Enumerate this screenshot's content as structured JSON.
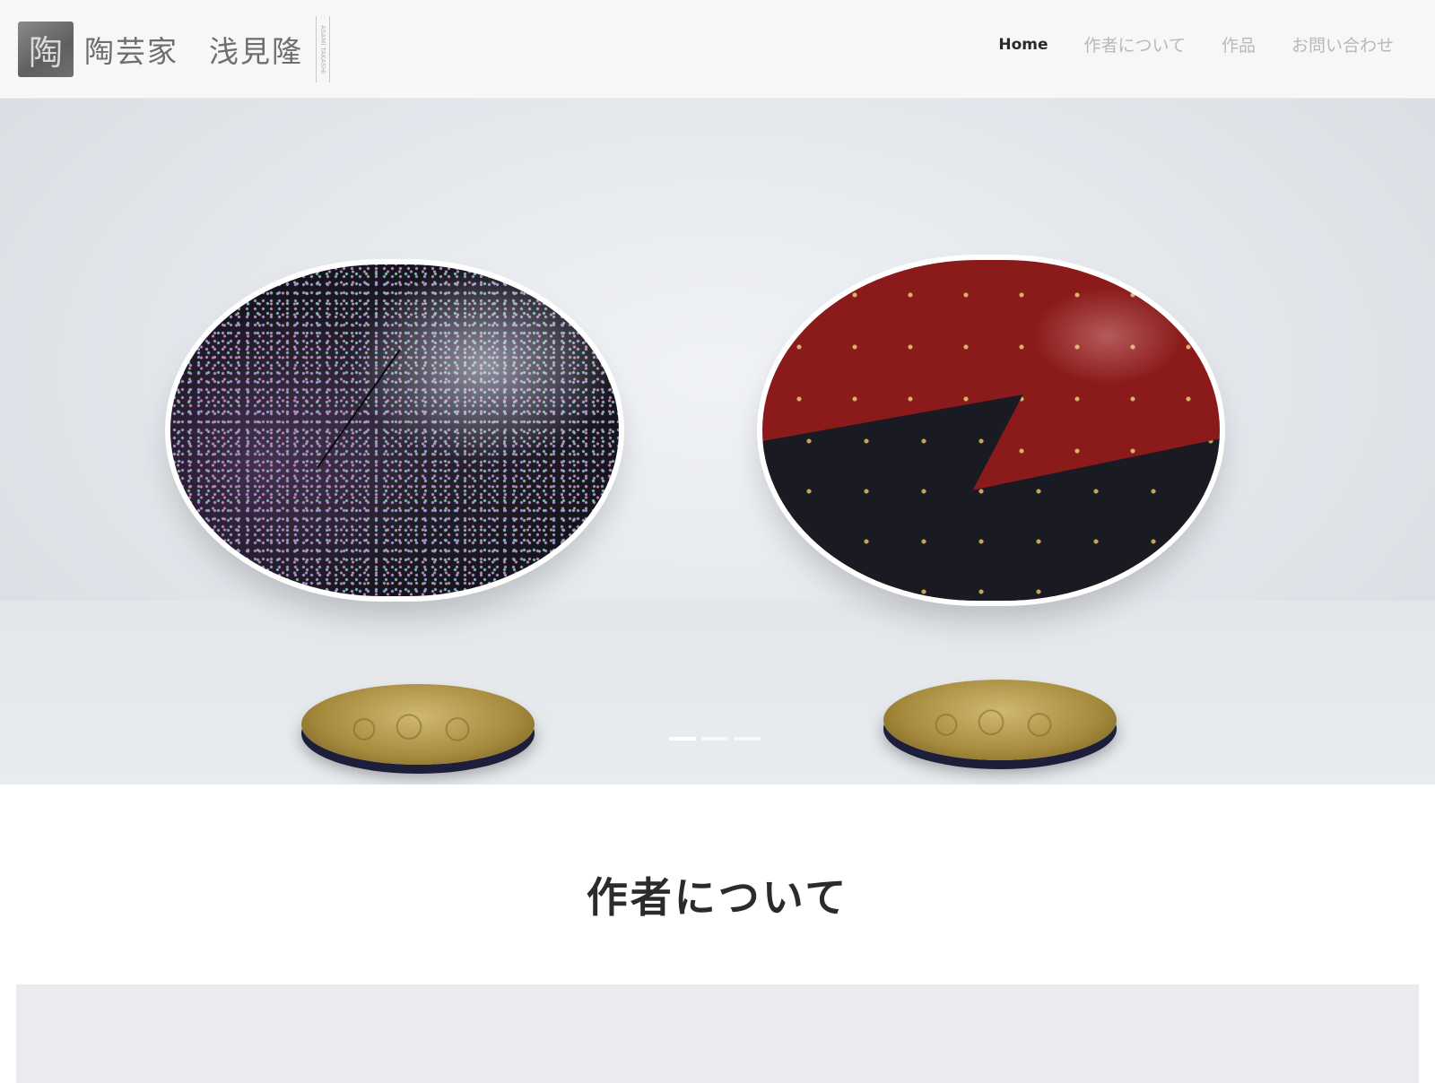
{
  "brand": {
    "logo_glyph": "陶",
    "title": "陶芸家",
    "name": "浅見隆",
    "vertical_text": "ASAMI TAKASHI"
  },
  "nav": {
    "items": [
      {
        "label": "Home",
        "active": true
      },
      {
        "label": "作者について",
        "active": false
      },
      {
        "label": "作品",
        "active": false
      },
      {
        "label": "お問い合わせ",
        "active": false
      }
    ]
  },
  "hero": {
    "slides_total": 3,
    "active_slide": 1
  },
  "about": {
    "heading": "作者について"
  },
  "colors": {
    "header_bg": "#f7f7f8",
    "hero_bg": "#e2e6eb",
    "nav_active": "#2a2a2a",
    "nav_inactive": "#b9b9b9",
    "lacquer_red": "#8b1a1a",
    "panel_bg": "#e9ebee"
  }
}
